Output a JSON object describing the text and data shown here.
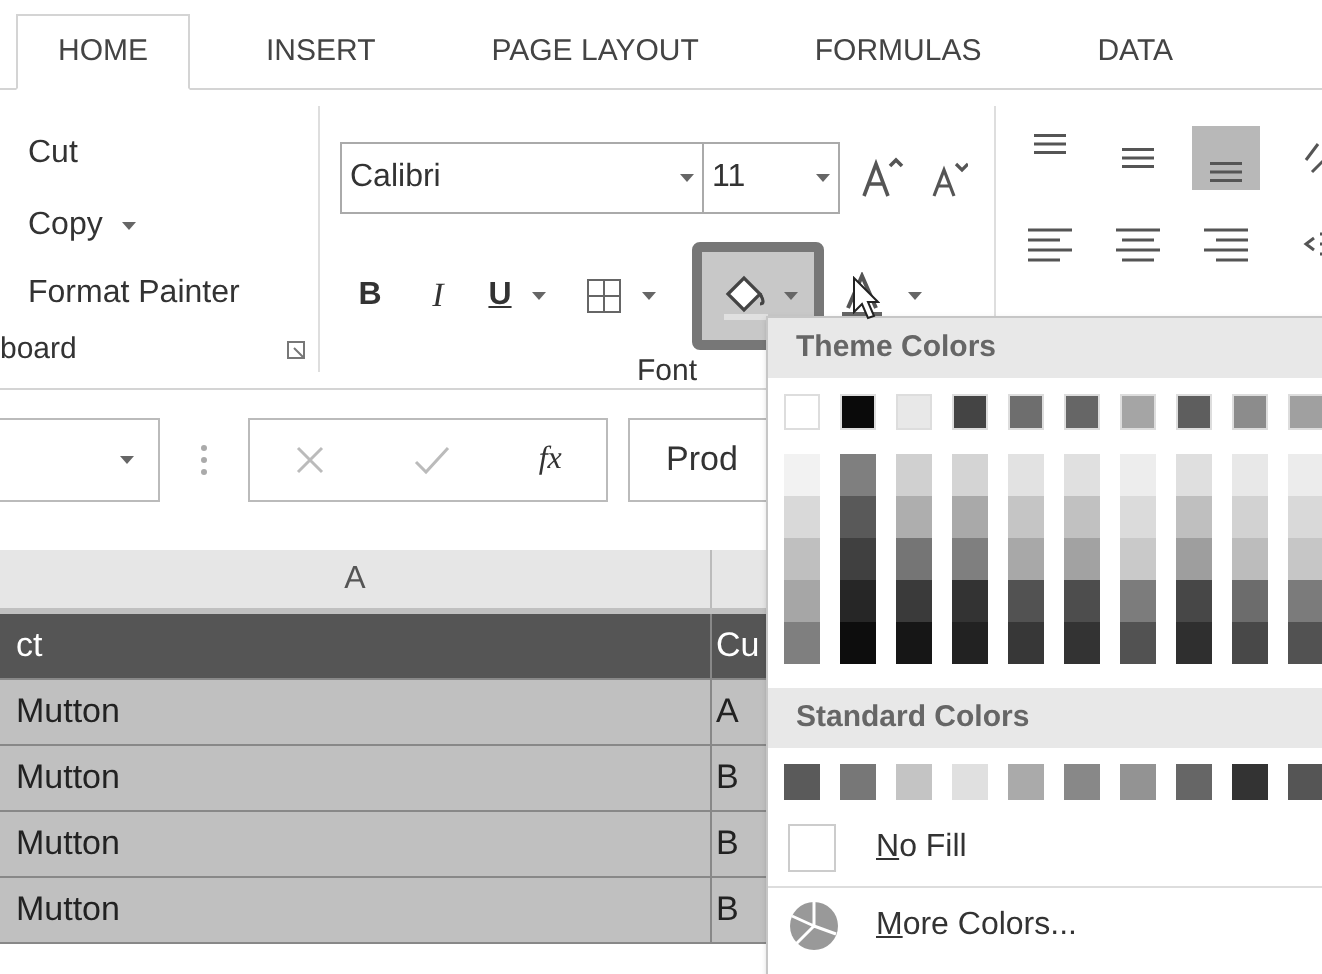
{
  "tabs": [
    {
      "label": "HOME",
      "selected": true
    },
    {
      "label": "INSERT",
      "selected": false
    },
    {
      "label": "PAGE LAYOUT",
      "selected": false
    },
    {
      "label": "FORMULAS",
      "selected": false
    },
    {
      "label": "DATA",
      "selected": false
    }
  ],
  "clipboard": {
    "items": [
      "Cut",
      "Copy",
      "Format Painter"
    ],
    "label": "board"
  },
  "font": {
    "name": "Calibri",
    "size": "11",
    "label": "Font",
    "fill_open": true,
    "bold": "B",
    "italic": "I",
    "underline": "U"
  },
  "alignment": {
    "buttons": [
      {
        "kind": "top",
        "on": false
      },
      {
        "kind": "middle",
        "on": false
      },
      {
        "kind": "bottom",
        "on": true
      }
    ]
  },
  "formula_bar": {
    "function_button": "fx",
    "value": "Prod"
  },
  "sheet": {
    "column_header": "A",
    "rows": [
      {
        "a": "ct",
        "b": "Cu",
        "header": true
      },
      {
        "a": "Mutton",
        "b": "A",
        "header": false
      },
      {
        "a": "Mutton",
        "b": "B",
        "header": false
      },
      {
        "a": "Mutton",
        "b": "B",
        "header": false
      },
      {
        "a": "Mutton",
        "b": "B",
        "header": false
      }
    ]
  },
  "fill_menu": {
    "theme_title": "Theme Colors",
    "theme_top": [
      {
        "color": "#ffffff"
      },
      {
        "color": "#0a0a0a"
      },
      {
        "color": "#e8e8e8"
      },
      {
        "color": "#444444"
      },
      {
        "color": "#6e6e6e"
      },
      {
        "color": "#666666"
      },
      {
        "color": "#a5a5a5"
      },
      {
        "color": "#5e5e5e"
      },
      {
        "color": "#8c8c8c"
      },
      {
        "color": "#a0a0a0"
      }
    ],
    "theme_shades": [
      {
        "shades": [
          {
            "color": "#f2f2f2"
          },
          {
            "color": "#d9d9d9"
          },
          {
            "color": "#bfbfbf"
          },
          {
            "color": "#a6a6a6"
          },
          {
            "color": "#7f7f7f"
          }
        ]
      },
      {
        "shades": [
          {
            "color": "#7f7f7f"
          },
          {
            "color": "#595959"
          },
          {
            "color": "#404040"
          },
          {
            "color": "#262626"
          },
          {
            "color": "#0d0d0d"
          }
        ]
      },
      {
        "shades": [
          {
            "color": "#d0d0d0"
          },
          {
            "color": "#aeaeae"
          },
          {
            "color": "#757575"
          },
          {
            "color": "#3a3a3a"
          },
          {
            "color": "#161616"
          }
        ]
      },
      {
        "shades": [
          {
            "color": "#d4d4d4"
          },
          {
            "color": "#a9a9a9"
          },
          {
            "color": "#7f7f7f"
          },
          {
            "color": "#333333"
          },
          {
            "color": "#222222"
          }
        ]
      },
      {
        "shades": [
          {
            "color": "#e2e2e2"
          },
          {
            "color": "#c5c5c5"
          },
          {
            "color": "#a8a8a8"
          },
          {
            "color": "#525252"
          },
          {
            "color": "#373737"
          }
        ]
      },
      {
        "shades": [
          {
            "color": "#e0e0e0"
          },
          {
            "color": "#c1c1c1"
          },
          {
            "color": "#a2a2a2"
          },
          {
            "color": "#4d4d4d"
          },
          {
            "color": "#333333"
          }
        ]
      },
      {
        "shades": [
          {
            "color": "#ededed"
          },
          {
            "color": "#dbdbdb"
          },
          {
            "color": "#c9c9c9"
          },
          {
            "color": "#7c7c7c"
          },
          {
            "color": "#525252"
          }
        ]
      },
      {
        "shades": [
          {
            "color": "#dfdfdf"
          },
          {
            "color": "#bfbfbf"
          },
          {
            "color": "#9e9e9e"
          },
          {
            "color": "#474747"
          },
          {
            "color": "#2f2f2f"
          }
        ]
      },
      {
        "shades": [
          {
            "color": "#e8e8e8"
          },
          {
            "color": "#d2d2d2"
          },
          {
            "color": "#bcbcbc"
          },
          {
            "color": "#6c6c6c"
          },
          {
            "color": "#484848"
          }
        ]
      },
      {
        "shades": [
          {
            "color": "#ececec"
          },
          {
            "color": "#d9d9d9"
          },
          {
            "color": "#c6c6c6"
          },
          {
            "color": "#7b7b7b"
          },
          {
            "color": "#525252"
          }
        ]
      }
    ],
    "standard_title": "Standard Colors",
    "standard": [
      {
        "color": "#5a5a5a"
      },
      {
        "color": "#777777"
      },
      {
        "color": "#c4c4c4"
      },
      {
        "color": "#e0e0e0"
      },
      {
        "color": "#aaaaaa"
      },
      {
        "color": "#888888"
      },
      {
        "color": "#939393"
      },
      {
        "color": "#666666"
      },
      {
        "color": "#333333"
      },
      {
        "color": "#555555"
      }
    ],
    "no_fill": "No Fill",
    "more": "More Colors..."
  }
}
